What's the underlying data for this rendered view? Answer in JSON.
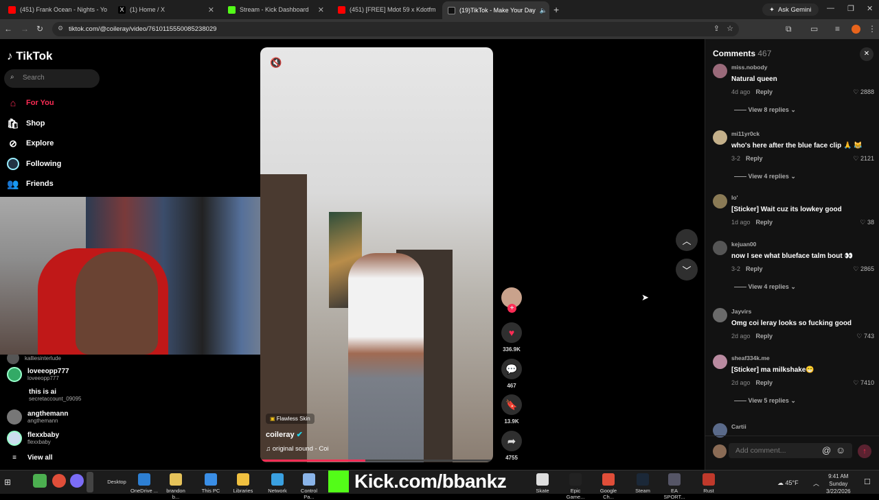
{
  "browser": {
    "tabs": [
      {
        "title": "(451) Frank Ocean - Nights - Yo",
        "color": "#ff0000"
      },
      {
        "title": "(1) Home / X",
        "color": "#ffffff"
      },
      {
        "title": "Stream - Kick Dashboard",
        "color": "#53fc18"
      },
      {
        "title": "(451) [FREE] Mdot 59 x Kdotfm",
        "color": "#ff0000"
      },
      {
        "title": "(19)TikTok - Make Your Day",
        "color": "#ffffff"
      }
    ],
    "ask_gemini": "Ask Gemini",
    "url": "tiktok.com/@coileray/video/7610115550085238029"
  },
  "sidebar": {
    "logo": "TikTok",
    "search_placeholder": "Search",
    "nav": [
      {
        "label": "For You",
        "icon": "home-icon",
        "active": true
      },
      {
        "label": "Shop",
        "icon": "shop-icon"
      },
      {
        "label": "Explore",
        "icon": "explore-icon"
      },
      {
        "label": "Following",
        "icon": "following-icon"
      },
      {
        "label": "Friends",
        "icon": "friends-icon"
      }
    ],
    "following": [
      {
        "name": "kalliesinterlude",
        "handle": ""
      },
      {
        "name": "loveeopp777",
        "handle": "loveeopp777"
      },
      {
        "name": "this is ai",
        "handle": "secretaccount_09095"
      },
      {
        "name": "angthemann",
        "handle": "angthemann"
      },
      {
        "name": "flexxbaby",
        "handle": "flexxbaby"
      }
    ],
    "view_all": "View all"
  },
  "video": {
    "effect": "Flawless Skin",
    "author": "coileray",
    "sound": "original sound - Coi",
    "progress": 0.45
  },
  "actions": {
    "likes": "336.9K",
    "comments": "467",
    "saves": "13.9K",
    "shares": "4755"
  },
  "comments_panel": {
    "title": "Comments",
    "count": "467",
    "reply_label": "Reply",
    "add_placeholder": "Add comment...",
    "items": [
      {
        "user": "miss.nobody",
        "text": "Natural queen",
        "date": "4d ago",
        "likes": "2888",
        "replies": "View 8 replies"
      },
      {
        "user": "mi11yr0ck",
        "text": "who's here after the blue face clip 🙏 😹",
        "date": "3-2",
        "likes": "2121",
        "replies": "View 4 replies"
      },
      {
        "user": "lo'",
        "text": "[Sticker] Wait cuz its lowkey good",
        "date": "1d ago",
        "likes": "38",
        "replies": ""
      },
      {
        "user": "kejuan00",
        "text": "now I see what blueface talm bout 👀",
        "date": "3-2",
        "likes": "2865",
        "replies": "View 4 replies"
      },
      {
        "user": "Jayvirs",
        "text": "Omg coi leray looks so fucking good",
        "date": "2d ago",
        "likes": "743",
        "replies": ""
      },
      {
        "user": "sheaf334k.me",
        "text": "[Sticker] ma milkshake😁",
        "date": "2d ago",
        "likes": "7410",
        "replies": "View 5 replies"
      },
      {
        "user": "Cartii",
        "text": "",
        "date": "",
        "likes": "",
        "replies": ""
      }
    ]
  },
  "taskbar": {
    "items": [
      "Desktop",
      "OneDrive ...",
      "brandon b...",
      "This PC",
      "Libraries",
      "Network",
      "Control Pa...",
      "Skate",
      "Epic Game...",
      "Google Ch...",
      "Steam",
      "EA SPORT...",
      "Rust"
    ],
    "overlay": "Kick.com/bbankz",
    "weather": "45°F",
    "time": "9:41 AM",
    "day": "Sunday",
    "date": "3/22/2026"
  }
}
